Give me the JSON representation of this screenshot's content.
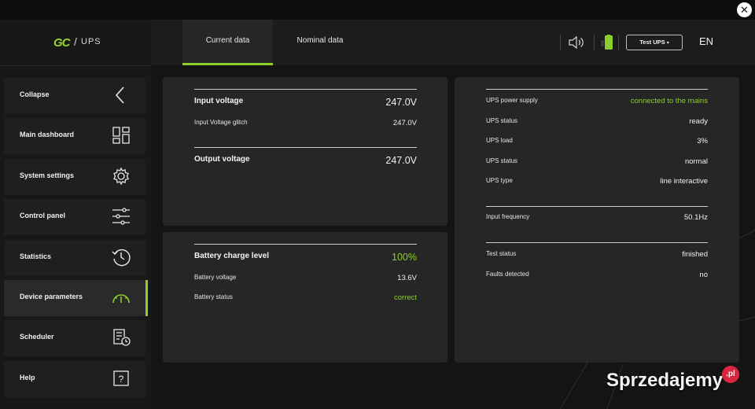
{
  "window": {
    "close_icon": "close-icon"
  },
  "brand": {
    "logo_mark": "GC",
    "separator": "/",
    "product": "UPS"
  },
  "sidebar": {
    "items": [
      {
        "label": "Collapse",
        "icon": "chevron-left-icon"
      },
      {
        "label": "Main dashboard",
        "icon": "dashboard-grid-icon"
      },
      {
        "label": "System settings",
        "icon": "gear-icon"
      },
      {
        "label": "Control panel",
        "icon": "sliders-icon"
      },
      {
        "label": "Statistics",
        "icon": "history-clock-icon"
      },
      {
        "label": "Device parameters",
        "icon": "gauge-icon",
        "active": true
      },
      {
        "label": "Scheduler",
        "icon": "schedule-doc-icon"
      },
      {
        "label": "Help",
        "icon": "question-icon"
      }
    ]
  },
  "tabs": [
    {
      "label": "Current data",
      "active": true
    },
    {
      "label": "Nominal data",
      "active": false
    }
  ],
  "header": {
    "sound_icon": "speaker-icon",
    "battery_icon": "battery-icon",
    "device_select": "Test UPS",
    "language": "EN"
  },
  "voltage": {
    "input_label": "Input voltage",
    "input_value": "247.0V",
    "glitch_label": "Input Voltage glitch",
    "glitch_value": "247.0V",
    "output_label": "Output voltage",
    "output_value": "247.0V"
  },
  "battery": {
    "charge_label": "Battery charge level",
    "charge_value": "100%",
    "voltage_label": "Battery voltage",
    "voltage_value": "13.6V",
    "status_label": "Battery status",
    "status_value": "correct"
  },
  "status": {
    "rows": [
      {
        "label": "UPS power supply",
        "value": "connected to the mains"
      },
      {
        "label": "UPS status",
        "value": "ready"
      },
      {
        "label": "UPS load",
        "value": "3%"
      },
      {
        "label": "UPS status",
        "value": "normal"
      },
      {
        "label": "UPS type",
        "value": "line interactive"
      }
    ],
    "frequency": {
      "label": "Input frequency",
      "value": "50.1Hz"
    },
    "test": {
      "label": "Test status",
      "value": "finished"
    },
    "faults": {
      "label": "Faults detected",
      "value": "no"
    }
  },
  "colors": {
    "accent": "#8ccf2c",
    "panel": "#262626",
    "background": "#141414",
    "sidebar": "#181818"
  },
  "watermark": {
    "text": "Sprzedajemy",
    "badge": ".pl"
  }
}
